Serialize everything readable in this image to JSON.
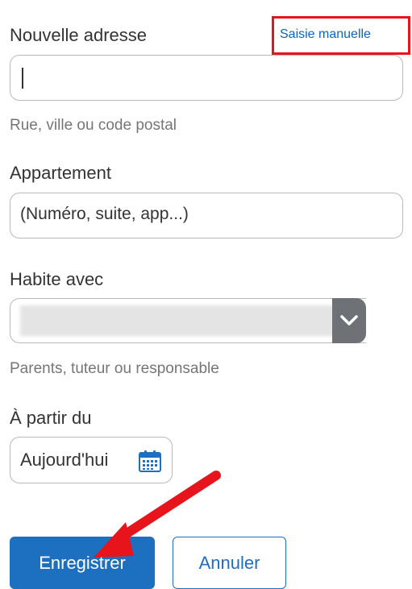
{
  "address": {
    "label": "Nouvelle adresse",
    "manual_link": "Saisie manuelle",
    "value": "",
    "hint": "Rue, ville ou code postal"
  },
  "apartment": {
    "label": "Appartement",
    "placeholder": "(Numéro, suite, app...)"
  },
  "lives_with": {
    "label": "Habite avec",
    "selected": "",
    "hint": "Parents, tuteur ou responsable",
    "icon": "chevron-down-icon"
  },
  "from_date": {
    "label": "À partir du",
    "value": "Aujourd'hui",
    "icon": "calendar-icon"
  },
  "actions": {
    "save": "Enregistrer",
    "cancel": "Annuler"
  },
  "colors": {
    "accent": "#1d6fbf",
    "annotation": "#e8141c"
  }
}
